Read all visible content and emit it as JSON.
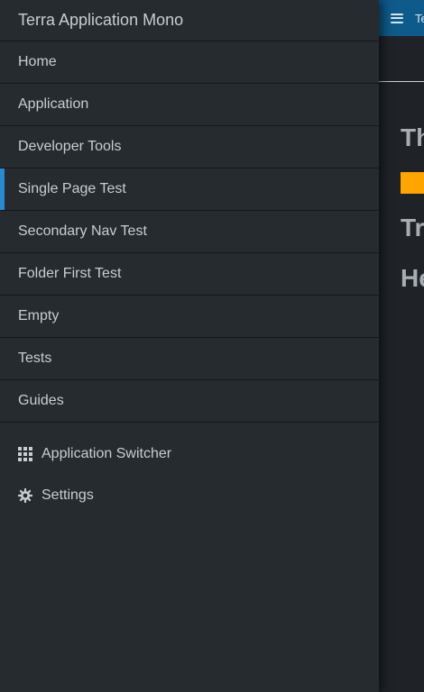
{
  "background": {
    "header_title": "Terra Application Mono",
    "heading_1": "The",
    "heading_2": "Try",
    "heading_3": "Hello"
  },
  "drawer": {
    "title": "Terra Application Mono",
    "nav_items": [
      {
        "label": "Home"
      },
      {
        "label": "Application"
      },
      {
        "label": "Developer Tools"
      },
      {
        "label": "Single Page Test",
        "selected": true
      },
      {
        "label": "Secondary Nav Test"
      },
      {
        "label": "Folder First Test"
      },
      {
        "label": "Empty"
      },
      {
        "label": "Tests"
      },
      {
        "label": "Guides"
      }
    ],
    "utility_items": [
      {
        "label": "Application Switcher",
        "icon": "grid-icon"
      },
      {
        "label": "Settings",
        "icon": "gear-icon"
      }
    ]
  },
  "colors": {
    "accent": "#2a8ad0",
    "header_blue": "#0e5a8a",
    "badge": "#ffa500",
    "drawer_bg": "#262b30"
  }
}
